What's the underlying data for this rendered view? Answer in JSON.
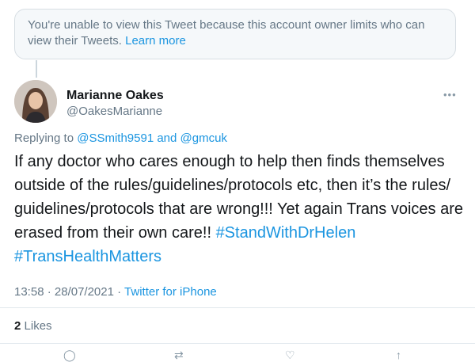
{
  "notice": {
    "text": "You're unable to view this Tweet because this account owner limits who can view their Tweets.",
    "link": "Learn more"
  },
  "author": {
    "name": "Marianne Oakes",
    "handle": "@OakesMarianne"
  },
  "reply": {
    "prefix": "Replying to",
    "user1": "@SSmith9591",
    "and": "and",
    "user2": "@gmcuk"
  },
  "tweet": {
    "text": "If any doctor who cares enough to help then finds themselves outside of the rules/guidelines/protocols etc, then it’s the rules/ guidelines/protocols that are wrong!!! Yet again Trans voices are erased from their own care!!",
    "hashtag1": "#StandWithDrHelen",
    "hashtag2": "#TransHealthMatters"
  },
  "meta": {
    "time": "13:58",
    "sep": "·",
    "date": "28/07/2021",
    "source": "Twitter for iPhone"
  },
  "stats": {
    "likes_count": "2",
    "likes_label": "Likes"
  },
  "icons": {
    "more": "more-icon",
    "reply": "reply-icon",
    "retweet": "retweet-icon",
    "like": "like-icon",
    "share": "share-icon"
  }
}
